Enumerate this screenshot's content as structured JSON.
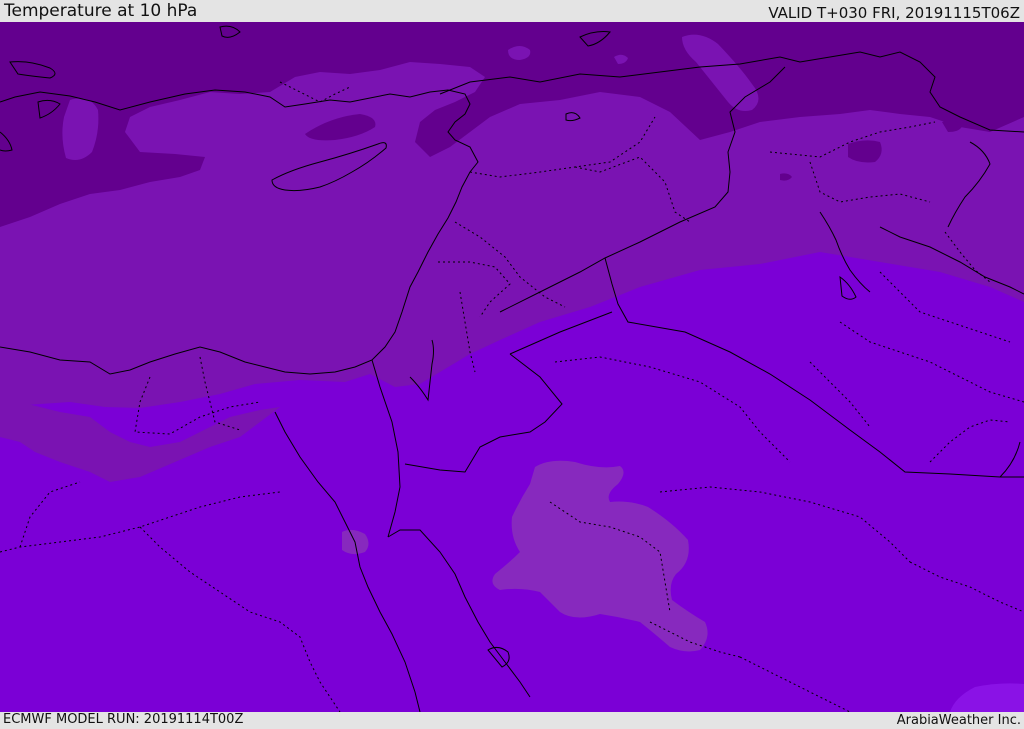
{
  "header": {
    "title": "Temperature at 10 hPa",
    "valid": "VALID T+030 FRI, 20191115T06Z"
  },
  "footer": {
    "model_run": "ECMWF MODEL RUN: 20191114T00Z",
    "credit": "ArabiaWeather Inc."
  },
  "map": {
    "colors": {
      "base": "#7b00d6",
      "band_mid": "#7a13b2",
      "band_cold": "#63008e",
      "band_warm": "#8a12e6",
      "patch_light": "#8729be"
    }
  }
}
